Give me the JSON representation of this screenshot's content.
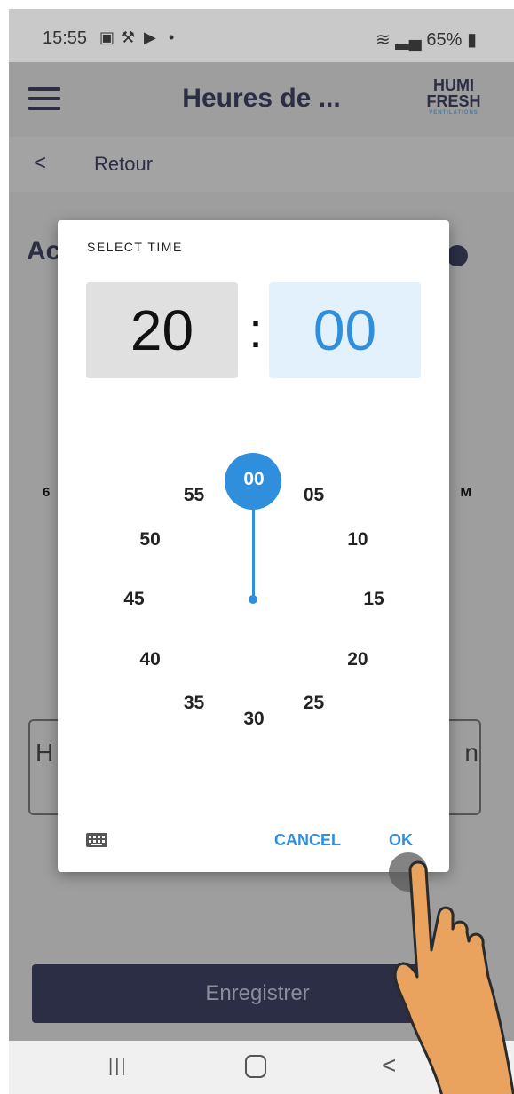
{
  "status_bar": {
    "time": "15:55",
    "battery": "65%"
  },
  "header": {
    "title": "Heures de ...",
    "logo_top": "HUMI",
    "logo_bottom": "FRESH",
    "logo_sub": "VENTILATIONS"
  },
  "nav": {
    "back_label": "Retour",
    "back_chevron": "<"
  },
  "background": {
    "heading_fragment": "Ac",
    "left_fragment": "6",
    "right_fragment": "M",
    "input_left_fragment": "H",
    "input_right_fragment": "n",
    "save_label": "Enregistrer"
  },
  "dialog": {
    "title": "SELECT TIME",
    "hour": "20",
    "separator": ":",
    "minute": "00",
    "minute_labels": [
      "00",
      "05",
      "10",
      "15",
      "20",
      "25",
      "30",
      "35",
      "40",
      "45",
      "50",
      "55"
    ],
    "cancel_label": "CANCEL",
    "ok_label": "OK"
  },
  "system_nav": {
    "recent": "|||",
    "back": "<"
  },
  "colors": {
    "accent": "#2f8fdd",
    "primary_dark": "#2b2e44",
    "hand": "#e9a35e"
  },
  "icons": [
    "hamburger-menu-icon",
    "keyboard-icon",
    "chevron-left-icon",
    "hand-pointer-icon"
  ]
}
